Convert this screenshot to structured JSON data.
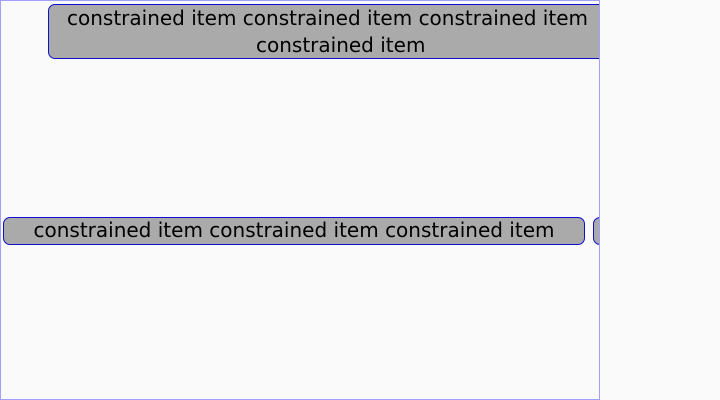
{
  "items": {
    "top_line1": "constrained item constrained item constrained item",
    "top_line2": "constrained item",
    "mid": "constrained item constrained item constrained item",
    "right": ""
  }
}
